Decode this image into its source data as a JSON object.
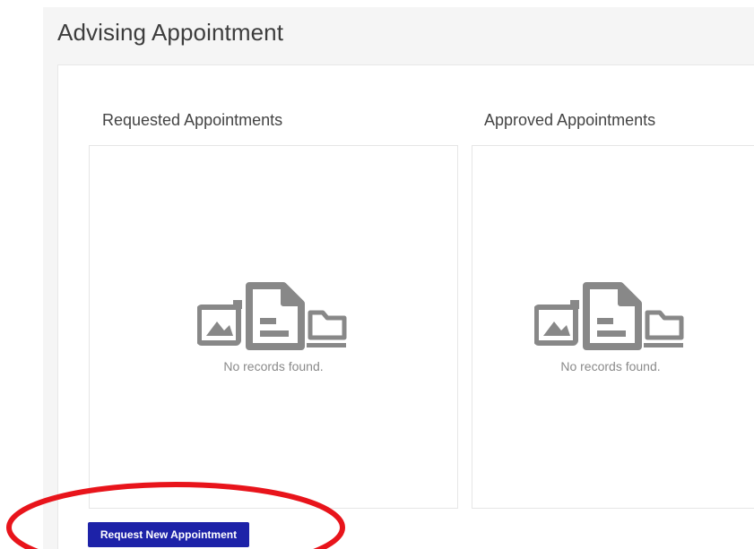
{
  "page": {
    "title": "Advising Appointment"
  },
  "requested": {
    "title": "Requested Appointments",
    "empty_text": "No records found."
  },
  "approved": {
    "title": "Approved Appointments",
    "empty_text": "No records found."
  },
  "actions": {
    "request_label": "Request New Appointment"
  },
  "colors": {
    "button_bg": "#1d22a8",
    "annotation": "#e8141b",
    "icon": "#888888"
  },
  "icons": {
    "empty_state": "image-document-folder-icon"
  }
}
